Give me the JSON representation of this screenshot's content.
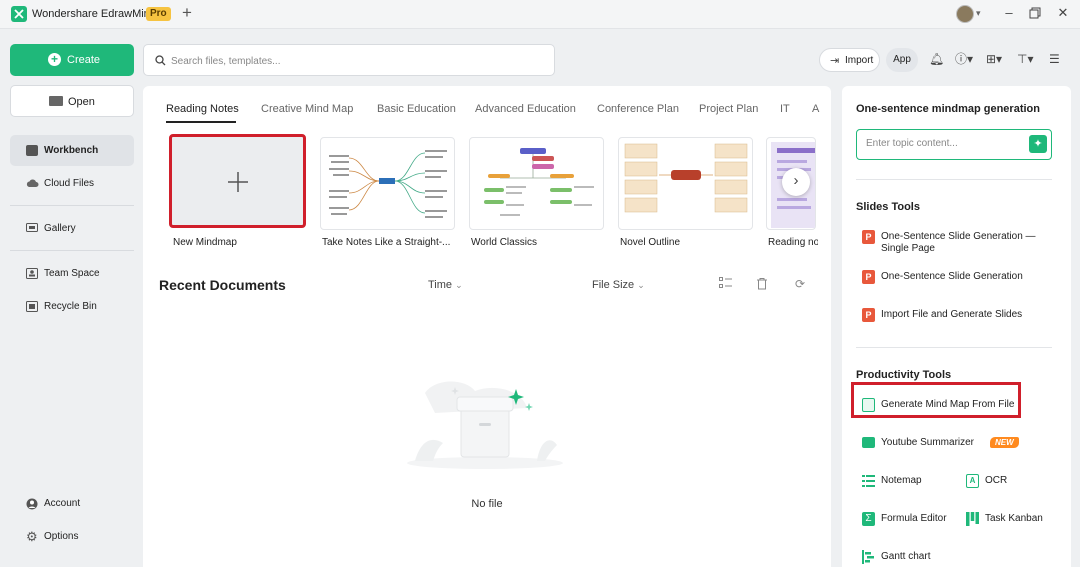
{
  "app": {
    "name": "Wondershare EdrawMind",
    "badge": "Pro",
    "new_tab_icon": "plus-icon"
  },
  "window_controls": [
    "minimize-icon",
    "restore-icon",
    "close-icon"
  ],
  "sidebar": {
    "create_label": "Create",
    "open_label": "Open",
    "items": [
      {
        "label": "Workbench",
        "icon": "workbench-icon",
        "active": true
      },
      {
        "label": "Cloud Files",
        "icon": "cloud-icon"
      },
      {
        "label": "Gallery",
        "icon": "gallery-icon"
      },
      {
        "label": "Team Space",
        "icon": "team-icon"
      },
      {
        "label": "Recycle Bin",
        "icon": "trash-icon"
      },
      {
        "label": "Account",
        "icon": "account-icon"
      },
      {
        "label": "Options",
        "icon": "gear-icon"
      }
    ]
  },
  "search": {
    "placeholder": "Search files, templates..."
  },
  "header": {
    "import_label": "Import",
    "app_label": "App"
  },
  "tabs": [
    "Reading Notes",
    "Creative Mind Map",
    "Basic Education",
    "Advanced Education",
    "Conference Plan",
    "Project Plan",
    "IT",
    "A"
  ],
  "templates": [
    {
      "label": "New Mindmap"
    },
    {
      "label": "Take Notes Like a Straight-..."
    },
    {
      "label": "World Classics"
    },
    {
      "label": "Novel Outline"
    },
    {
      "label": "Reading no"
    }
  ],
  "recent": {
    "title": "Recent Documents",
    "col_time": "Time",
    "col_size": "File Size",
    "empty_text": "No file"
  },
  "right_panel": {
    "gen_title": "One-sentence mindmap generation",
    "gen_placeholder": "Enter topic content...",
    "slides_title": "Slides Tools",
    "slides": [
      {
        "label_line1": "One-Sentence Slide Generation —",
        "label_line2": "Single Page"
      },
      {
        "label": "One-Sentence Slide Generation"
      },
      {
        "label": "Import File and Generate Slides"
      }
    ],
    "productivity_title": "Productivity Tools",
    "productivity": [
      {
        "label": "Generate Mind Map From File"
      },
      {
        "label": "Youtube Summarizer",
        "badge": "NEW"
      },
      {
        "label": "Notemap"
      },
      {
        "label": "OCR"
      },
      {
        "label": "Formula Editor"
      },
      {
        "label": "Task Kanban"
      },
      {
        "label": "Gantt chart"
      }
    ]
  },
  "colors": {
    "accent": "#1fb87a",
    "highlight": "#d01f2b",
    "slide_icon": "#e8583b",
    "new_badge": "#ff8a1f"
  }
}
